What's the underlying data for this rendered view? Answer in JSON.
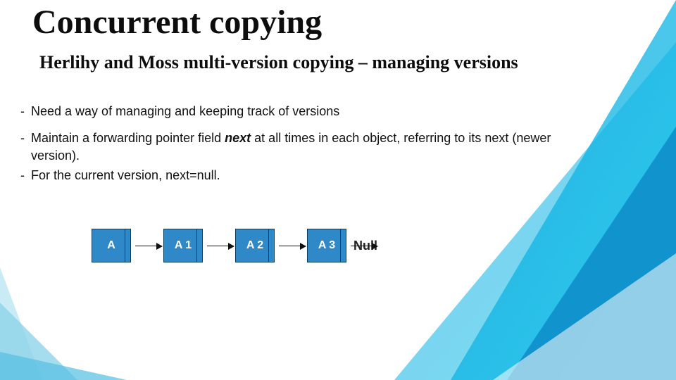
{
  "title": "Concurrent copying",
  "subtitle": "Herlihy and Moss multi-version copying – managing versions",
  "bullets": [
    {
      "before": "Need a way of managing and keeping track of versions",
      "bold": "",
      "after": ""
    },
    {
      "before": "Maintain a forwarding pointer field ",
      "bold": "next",
      "after": " at all times in each object, referring to its next (newer version)."
    },
    {
      "before": "For the current version, next=null.",
      "bold": "",
      "after": ""
    }
  ],
  "diagram": {
    "nodes": [
      "A",
      "A 1",
      "A 2",
      "A 3"
    ],
    "terminal": "Null"
  }
}
